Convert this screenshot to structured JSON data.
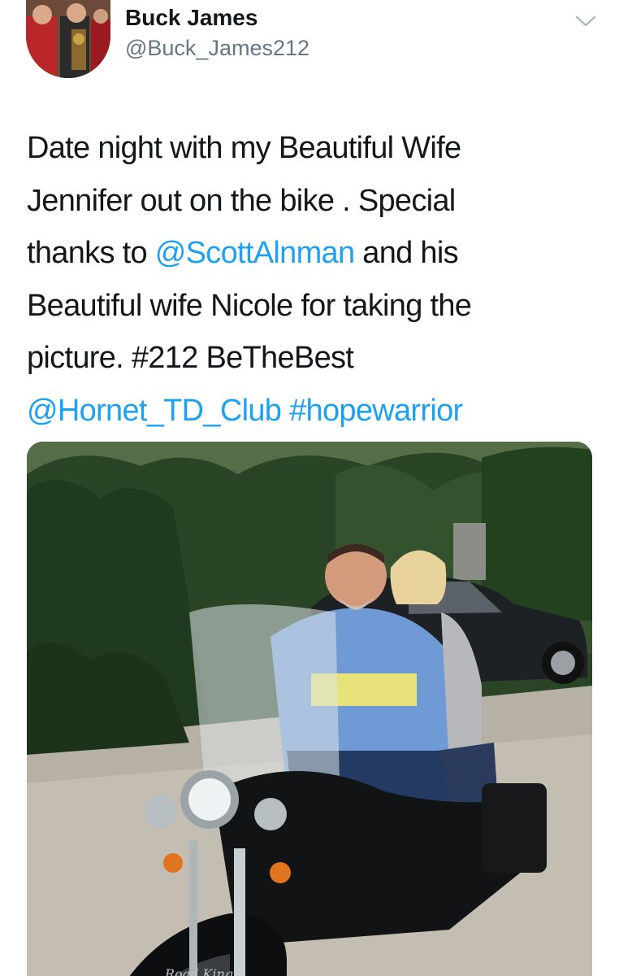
{
  "user": {
    "display_name": "Buck James",
    "handle": "@Buck_James212"
  },
  "tweet": {
    "line1": "Date night with my Beautiful Wife",
    "line2": "Jennifer out on the bike . Special",
    "line3_pre": "thanks to ",
    "line3_mention": "@ScottAlnman",
    "line3_post": " and his",
    "line4": "Beautiful wife Nicole for taking the",
    "line5": "picture. #212 BeTheBest",
    "line6_mention": "@Hornet_TD_Club",
    "line6_sep": " ",
    "line6_hashtag": "#hopewarrior"
  },
  "photo": {
    "plate_text": "Road King"
  },
  "colors": {
    "link": "#1da1f2",
    "name": "#14171a",
    "handle": "#657786"
  },
  "icons": {
    "menu": "chevron-down-icon"
  }
}
